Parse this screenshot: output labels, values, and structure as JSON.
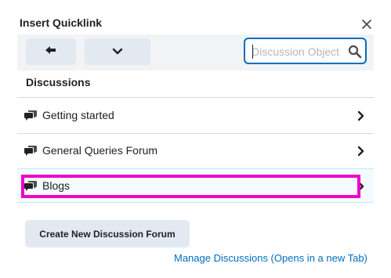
{
  "dialog": {
    "title": "Insert Quicklink",
    "close_icon": "close-icon"
  },
  "toolbar": {
    "back_icon": "back-arrow-icon",
    "dropdown_icon": "chevron-down-icon"
  },
  "search": {
    "placeholder": "Discussion Objects",
    "value": "",
    "icon": "search-icon"
  },
  "section": {
    "heading": "Discussions"
  },
  "items": [
    {
      "label": "Getting started",
      "icon": "discussion-icon",
      "selected": false
    },
    {
      "label": "General Queries Forum",
      "icon": "discussion-icon",
      "selected": false
    },
    {
      "label": "Blogs",
      "icon": "discussion-icon",
      "selected": true
    }
  ],
  "actions": {
    "create_label": "Create New Discussion Forum",
    "manage_label": "Manage Discussions (Opens in a new Tab)"
  },
  "colors": {
    "accent": "#006fbf",
    "highlight": "#f000c8",
    "button_bg": "#e3e9f1",
    "selected_bg": "#f3fbff"
  }
}
